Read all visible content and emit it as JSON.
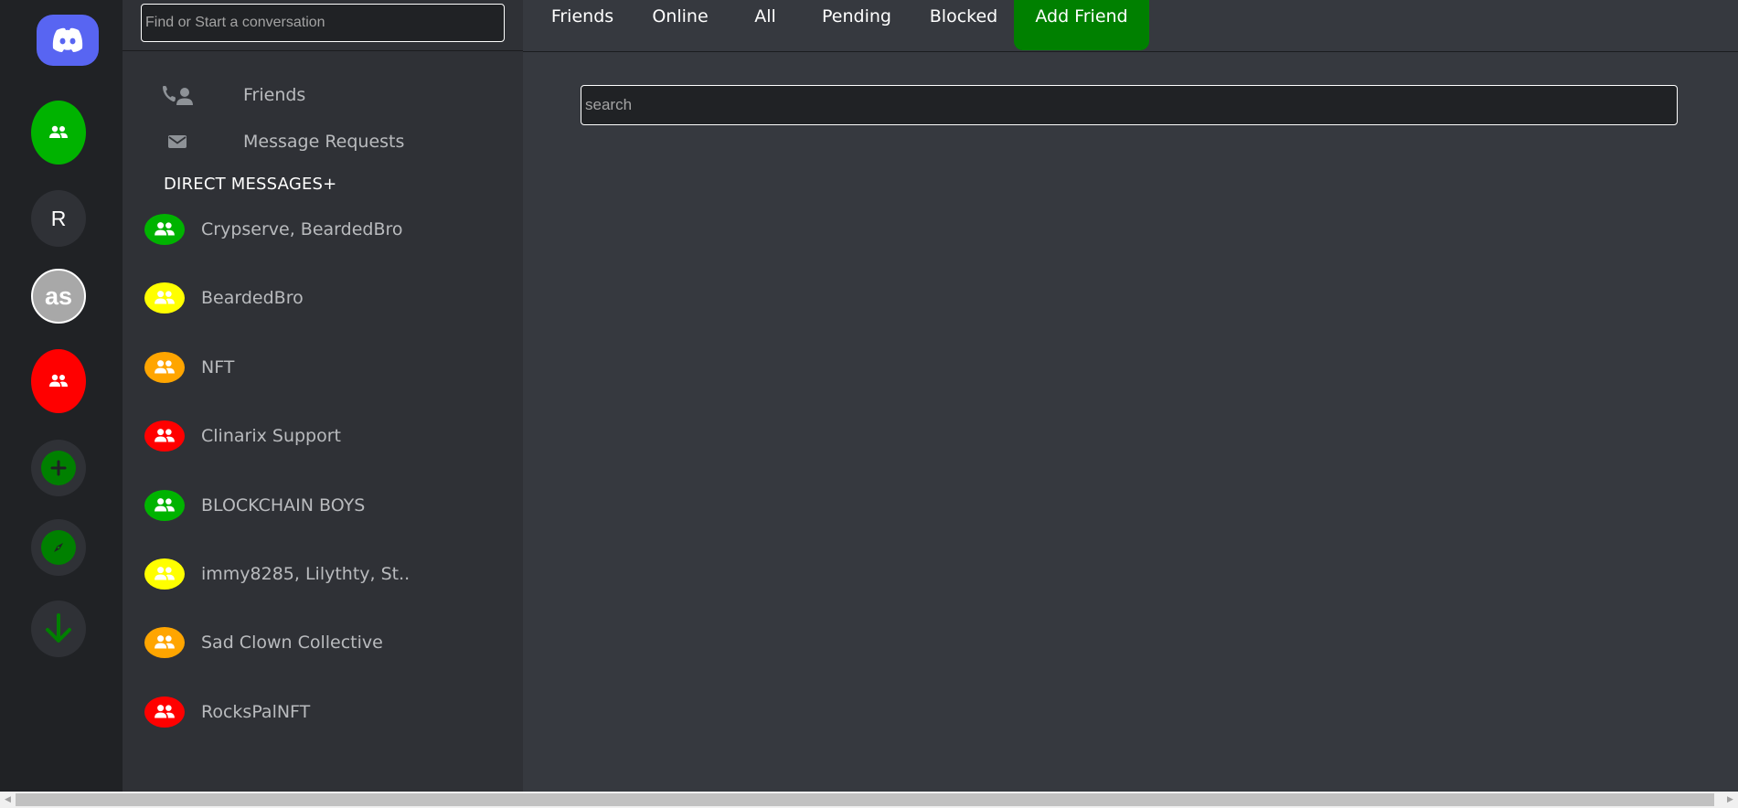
{
  "servers": {
    "r_label": "R",
    "as_label": "as"
  },
  "dm_panel": {
    "search_placeholder": "Find or Start a conversation",
    "nav": {
      "friends_label": "Friends",
      "requests_label": "Message Requests"
    },
    "header": "DIRECT MESSAGES+",
    "conversations": [
      {
        "name": "Crypserve, BeardedBro",
        "color": "#00b300"
      },
      {
        "name": "BeardedBro",
        "color": "#ffff00"
      },
      {
        "name": "NFT",
        "color": "#ffa500"
      },
      {
        "name": "Clinarix Support",
        "color": "#ff0000"
      },
      {
        "name": "BLOCKCHAIN BOYS",
        "color": "#00b300"
      },
      {
        "name": "immy8285, Lilythty, St..",
        "color": "#ffff00"
      },
      {
        "name": "Sad Clown Collective",
        "color": "#ffa500"
      },
      {
        "name": "RocksPalNFT",
        "color": "#ff0000"
      }
    ]
  },
  "tabs": {
    "friends": "Friends",
    "online": "Online",
    "all": "All",
    "pending": "Pending",
    "blocked": "Blocked",
    "add_friend": "Add Friend"
  },
  "main": {
    "search_placeholder": "search"
  },
  "colors": {
    "accent_green": "#008000",
    "brand_blurple": "#5865f2"
  }
}
